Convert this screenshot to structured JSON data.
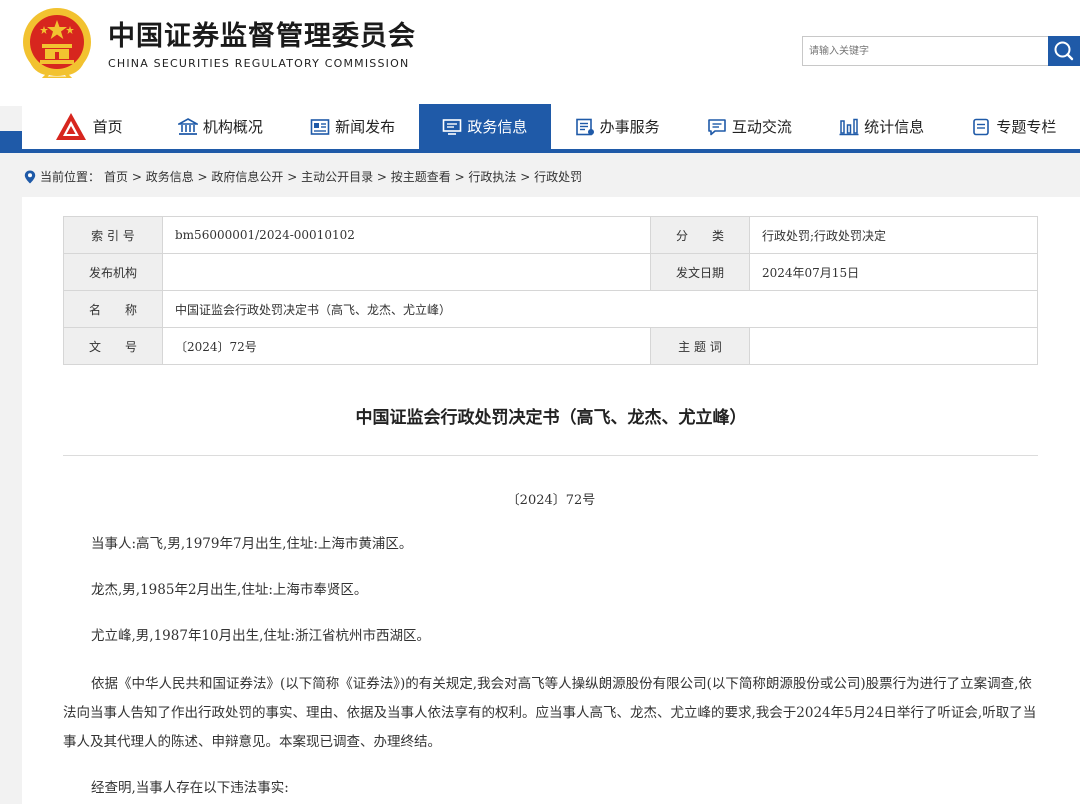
{
  "header": {
    "org_name": "中国证券监督管理委员会",
    "org_en": "CHINA SECURITIES REGULATORY COMMISSION",
    "search_placeholder": "请输入关键字",
    "colors": {
      "brand": "#1f5aa8",
      "emblem_red": "#d7261e",
      "emblem_gold": "#f2c230"
    }
  },
  "nav": [
    {
      "label": "首页",
      "icon": "home-logo-icon",
      "active": false
    },
    {
      "label": "机构概况",
      "icon": "building-icon",
      "active": false
    },
    {
      "label": "新闻发布",
      "icon": "news-icon",
      "active": false
    },
    {
      "label": "政务信息",
      "icon": "screen-info-icon",
      "active": true
    },
    {
      "label": "办事服务",
      "icon": "service-icon",
      "active": false
    },
    {
      "label": "互动交流",
      "icon": "chat-icon",
      "active": false
    },
    {
      "label": "统计信息",
      "icon": "bar-chart-icon",
      "active": false
    },
    {
      "label": "专题专栏",
      "icon": "document-icon",
      "active": false
    }
  ],
  "breadcrumb": {
    "prefix": "当前位置：",
    "path": "首页 > 政务信息 > 政府信息公开 > 主动公开目录 > 按主题查看 > 行政执法 > 行政处罚"
  },
  "meta": {
    "index_label": "索 引 号",
    "index_value": "bm56000001/2024-00010102",
    "category_label": "分　　类",
    "category_value": "行政处罚;行政处罚决定",
    "publisher_label": "发布机构",
    "publisher_value": "",
    "date_label": "发文日期",
    "date_value": "2024年07月15日",
    "name_label": "名　　称",
    "name_value": "中国证监会行政处罚决定书（高飞、龙杰、尤立峰）",
    "docno_label": "文　　号",
    "docno_value": "〔2024〕72号",
    "keywords_label": "主 题 词",
    "keywords_value": ""
  },
  "document": {
    "title": "中国证监会行政处罚决定书（高飞、龙杰、尤立峰）",
    "number": "〔2024〕72号",
    "paragraphs": [
      "当事人:高飞,男,1979年7月出生,住址:上海市黄浦区。",
      "龙杰,男,1985年2月出生,住址:上海市奉贤区。",
      "尤立峰,男,1987年10月出生,住址:浙江省杭州市西湖区。",
      "依据《中华人民共和国证券法》(以下简称《证券法》)的有关规定,我会对高飞等人操纵朗源股份有限公司(以下简称朗源股份或公司)股票行为进行了立案调查,依法向当事人告知了作出行政处罚的事实、理由、依据及当事人依法享有的权利。应当事人高飞、龙杰、尤立峰的要求,我会于2024年5月24日举行了听证会,听取了当事人及其代理人的陈述、申辩意见。本案现已调查、办理终结。",
      "经查明,当事人存在以下违法事实:"
    ]
  }
}
